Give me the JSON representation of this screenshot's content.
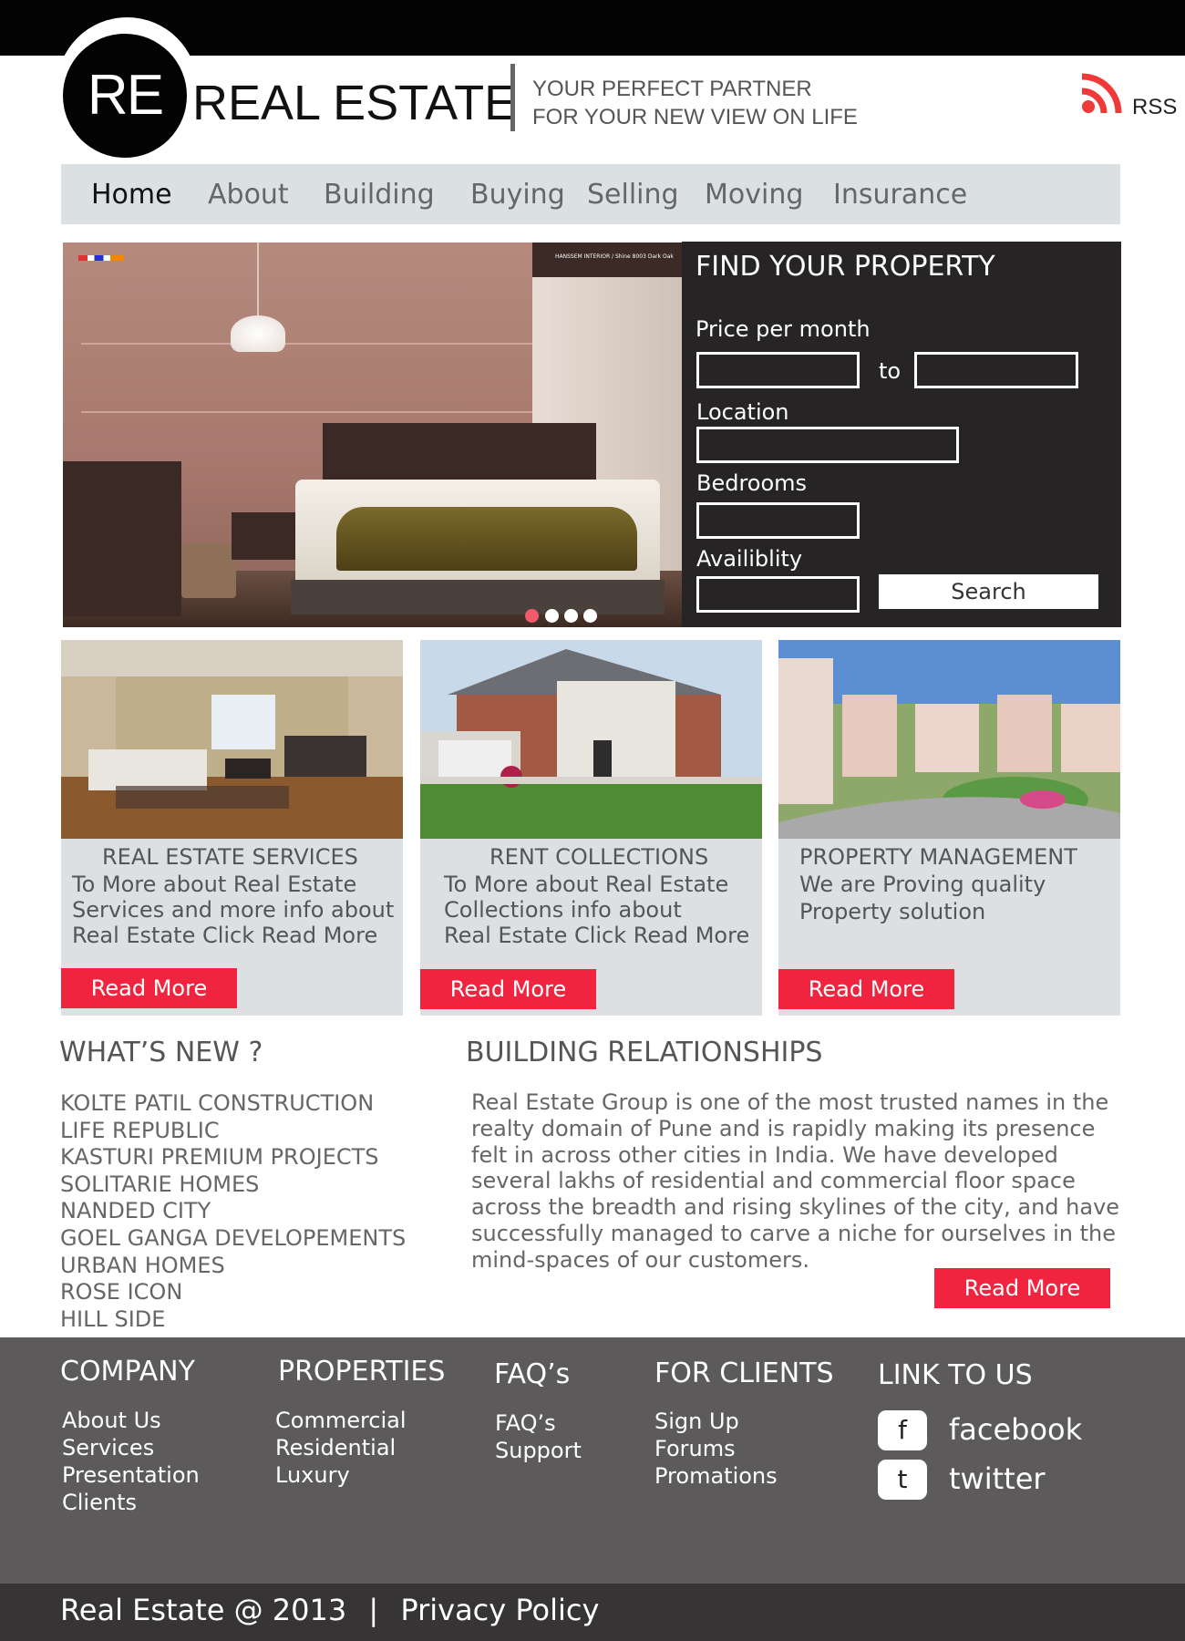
{
  "header": {
    "logo_text": "RE",
    "brand": "REAL ESTATE",
    "tagline_line1": "YOUR PERFECT PARTNER",
    "tagline_line2": "FOR YOUR NEW VIEW ON LIFE",
    "rss_label": "RSS",
    "rss_icon": "rss-icon"
  },
  "nav": {
    "items": [
      {
        "label": "Home",
        "active": true
      },
      {
        "label": "About"
      },
      {
        "label": "Building"
      },
      {
        "label": "Buying"
      },
      {
        "label": "Selling"
      },
      {
        "label": "Moving"
      },
      {
        "label": "Insurance"
      }
    ]
  },
  "slider": {
    "slide_count": 4,
    "active_slide": 1,
    "watermark": "HANSSEM INTERIOR / Shine 8003 Dark Oak"
  },
  "search": {
    "title": "FIND YOUR PROPERTY",
    "price_label": "Price per month",
    "to_label": "to",
    "price_from": "",
    "price_to": "",
    "location_label": "Location",
    "location": "",
    "bedrooms_label": "Bedrooms",
    "bedrooms": "",
    "availability_label": "Availiblity",
    "availability": "",
    "search_button": "Search"
  },
  "cards": [
    {
      "title": "REAL ESTATE SERVICES",
      "text": "To More about Real Estate\nServices and more info about\nReal Estate Click Read More",
      "button": "Read More",
      "image": "bedroom-interior-photo"
    },
    {
      "title": "RENT COLLECTIONS",
      "text": "To More about Real Estate\nCollections info about\nReal Estate Click Read More",
      "button": "Read More",
      "image": "house-exterior-photo"
    },
    {
      "title": "PROPERTY MANAGEMENT",
      "text": "We are Proving quality\nProperty solution",
      "button": "Read More",
      "image": "apartment-complex-photo"
    }
  ],
  "whats_new": {
    "title": "WHAT’S NEW ?",
    "items": [
      "KOLTE PATIL CONSTRUCTION",
      "LIFE REPUBLIC",
      "KASTURI PREMIUM PROJECTS",
      "SOLITARIE HOMES",
      "NANDED CITY",
      "GOEL GANGA DEVELOPEMENTS",
      "URBAN HOMES",
      "ROSE ICON",
      "HILL SIDE"
    ]
  },
  "relationships": {
    "title": "BUILDING RELATIONSHIPS",
    "text": "Real Estate Group is one of the most trusted names in the realty domain of Pune and is rapidly making its presence felt in across other cities in India. We have developed several lakhs of residential and commercial floor space across the breadth and rising skylines of the city, and have successfully managed to carve a niche for ourselves in the mind-spaces of our customers.",
    "button": "Read More"
  },
  "footer": {
    "company": {
      "title": "COMPANY",
      "links": [
        "About Us",
        "Services",
        "Presentation",
        "Clients"
      ]
    },
    "properties": {
      "title": "PROPERTIES",
      "links": [
        "Commercial",
        "Residential",
        "Luxury"
      ]
    },
    "faq": {
      "title": "FAQ’s",
      "links": [
        "FAQ’s",
        "Support"
      ]
    },
    "clients": {
      "title": "FOR CLIENTS",
      "links": [
        "Sign Up",
        "Forums",
        "Promations"
      ]
    },
    "social": {
      "title": "LINK TO US",
      "facebook_glyph": "f",
      "facebook_label": "facebook",
      "twitter_glyph": "t",
      "twitter_label": "twitter"
    },
    "copyright": "Real Estate @ 2013",
    "separator": "|",
    "privacy": "Privacy Policy"
  },
  "colors": {
    "accent_red": "#f0243e",
    "nav_bg": "#dbe0e3",
    "search_panel": "#262424",
    "footer_bg": "#5c5a5b",
    "footer_bottom": "#363435",
    "rss": "#f03a3a"
  }
}
